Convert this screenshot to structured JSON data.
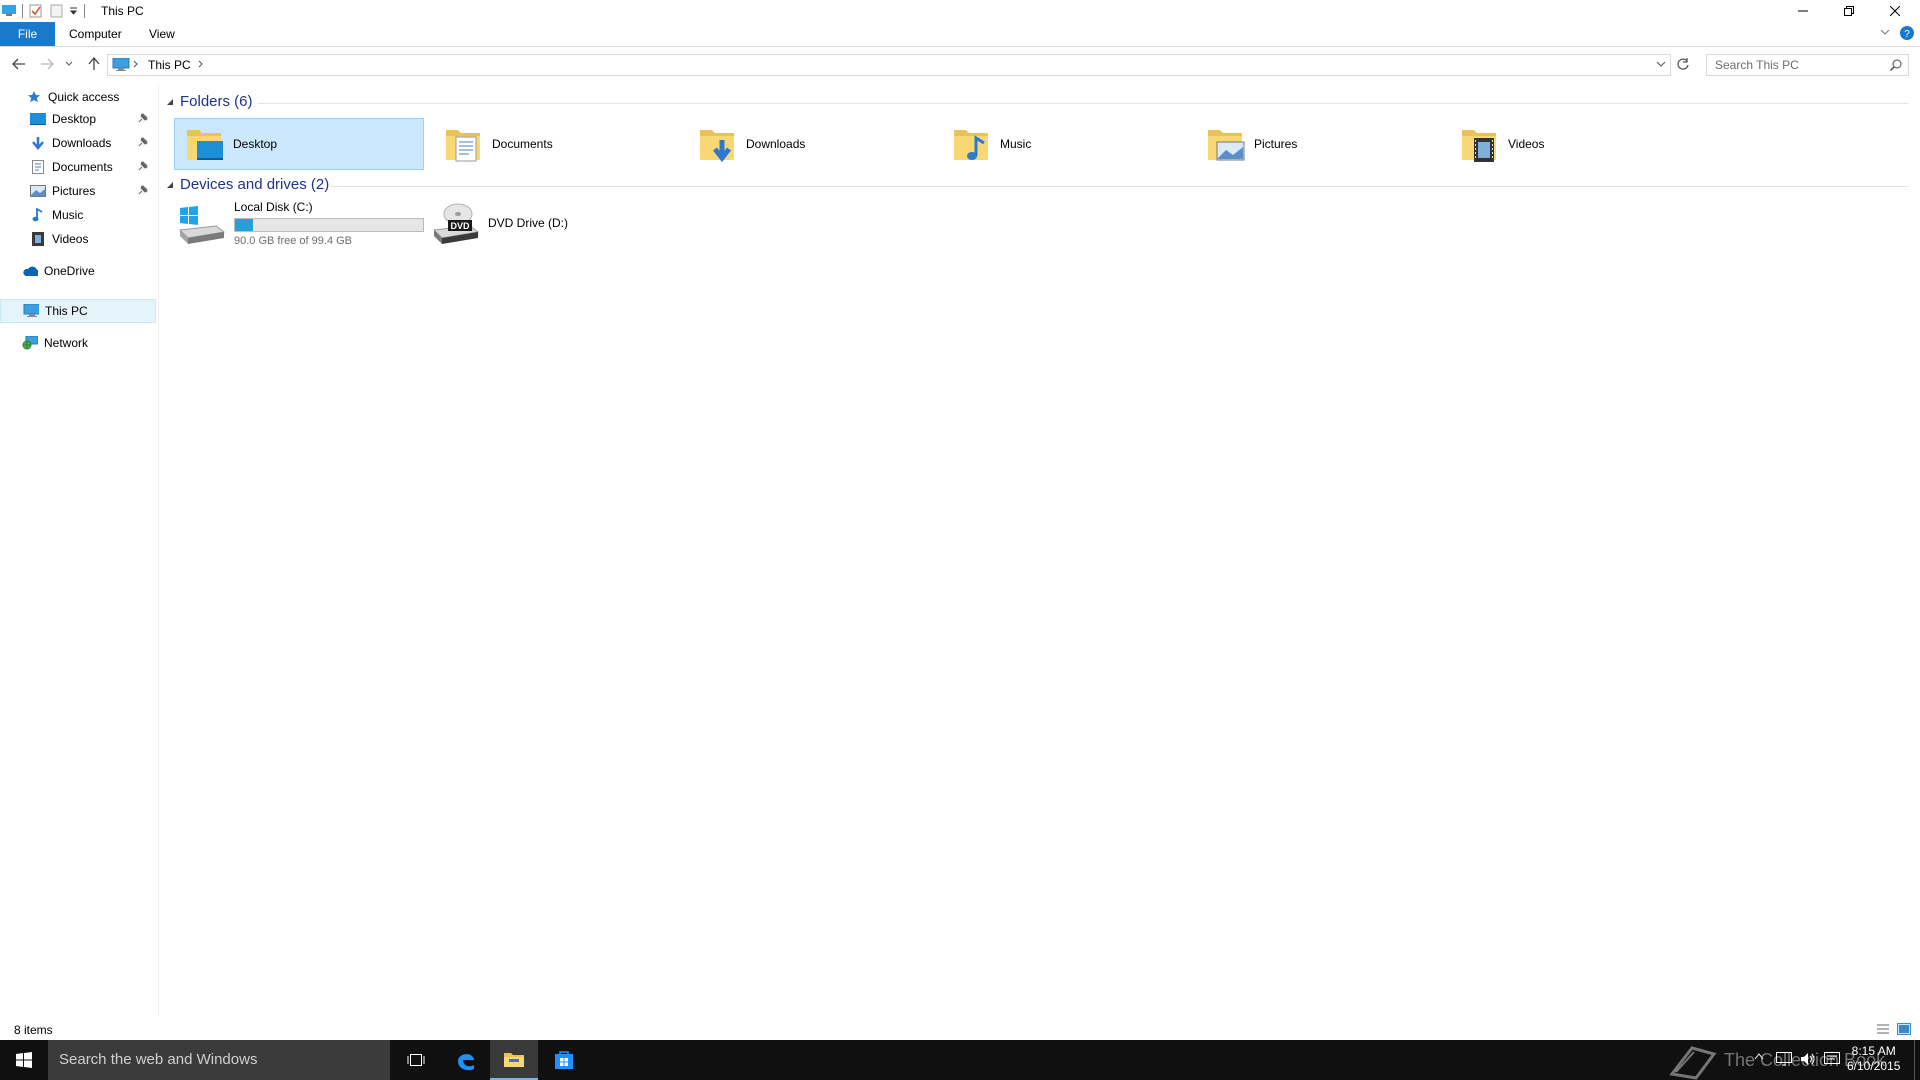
{
  "window": {
    "title": "This PC"
  },
  "ribbon": {
    "tabs": [
      "File",
      "Computer",
      "View"
    ]
  },
  "address": {
    "crumb": "This PC",
    "search_placeholder": "Search This PC"
  },
  "sidebar": {
    "quick_access": "Quick access",
    "items": [
      {
        "label": "Desktop",
        "pinned": true
      },
      {
        "label": "Downloads",
        "pinned": true
      },
      {
        "label": "Documents",
        "pinned": true
      },
      {
        "label": "Pictures",
        "pinned": true
      },
      {
        "label": "Music",
        "pinned": false
      },
      {
        "label": "Videos",
        "pinned": false
      }
    ],
    "onedrive": "OneDrive",
    "this_pc": "This PC",
    "network": "Network"
  },
  "content": {
    "folders_header": "Folders (6)",
    "folders": [
      "Desktop",
      "Documents",
      "Downloads",
      "Music",
      "Pictures",
      "Videos"
    ],
    "devices_header": "Devices and drives (2)",
    "drives": [
      {
        "name": "Local Disk (C:)",
        "detail": "90.0 GB free of 99.4 GB",
        "used_fraction": 0.094
      },
      {
        "name": "DVD Drive (D:)"
      }
    ],
    "dvd_badge": "DVD"
  },
  "status": {
    "items": "8 items"
  },
  "taskbar": {
    "search_placeholder": "Search the web and Windows",
    "time": "8:15 AM",
    "date": "6/10/2015",
    "watermark": "The Collection Book"
  },
  "colors": {
    "accent": "#1979ca",
    "selection": "#cce8ff",
    "header_text": "#1e3287",
    "drive_bar": "#26a0da"
  }
}
